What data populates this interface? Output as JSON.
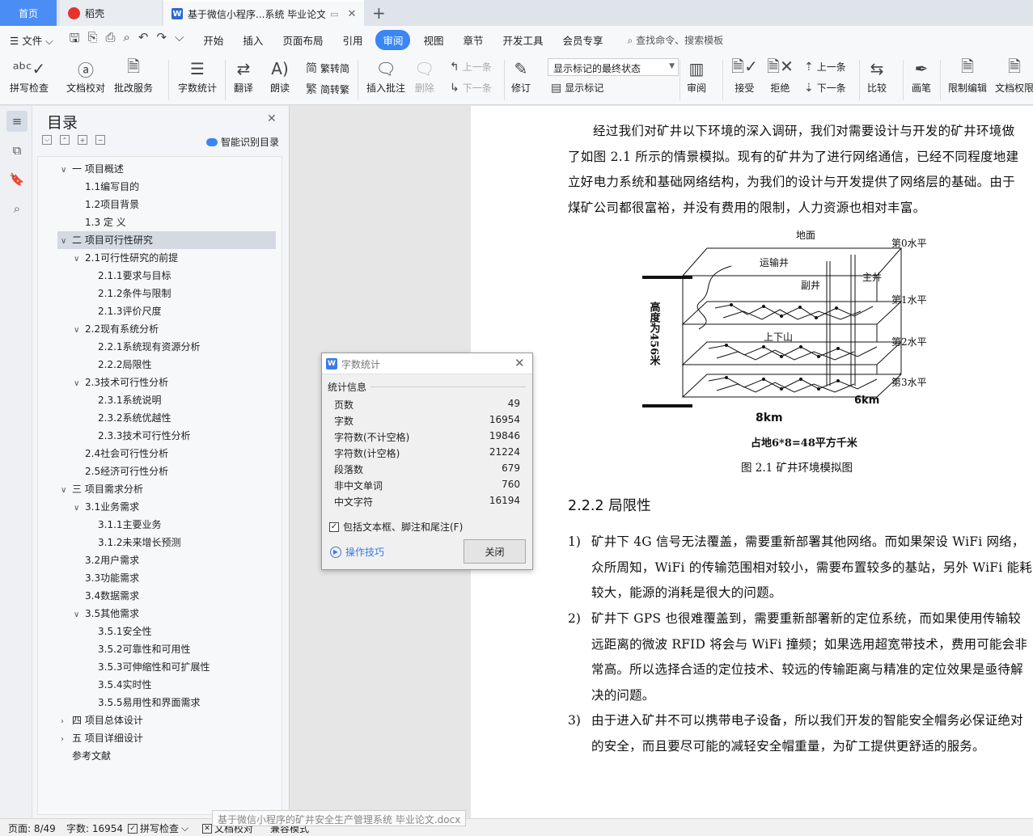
{
  "tabs": {
    "home": "首页",
    "daoke": "稻壳",
    "doc": "基于微信小程序...系统 毕业论文",
    "doc_close": "✕",
    "new_tab": "+"
  },
  "menu": {
    "file": "文件",
    "items": [
      "开始",
      "插入",
      "页面布局",
      "引用",
      "审阅",
      "视图",
      "章节",
      "开发工具",
      "会员专享"
    ],
    "active": "审阅",
    "search": "查找命令、搜索模板"
  },
  "ribbon": {
    "spell": "拼写检查",
    "doc_check": "文档校对",
    "annot_service": "批改服务",
    "word_count": "字数统计",
    "translate": "翻译",
    "read_aloud": "朗读",
    "trad": "繁转简",
    "simp": "简转繁",
    "insert_comment": "插入批注",
    "delete": "删除",
    "prev_comment": "上一条",
    "next_comment": "下一条",
    "revise": "修订",
    "markup_state": "显示标记的最终状态",
    "show_markup": "显示标记",
    "review": "审阅",
    "accept": "接受",
    "reject": "拒绝",
    "prev": "上一条",
    "next": "下一条",
    "compare": "比较",
    "pen": "画笔",
    "restrict": "限制编辑",
    "doc_perm": "文档权限"
  },
  "toc": {
    "title": "目录",
    "ai_toc": "智能识别目录",
    "items": [
      {
        "label": "一 项目概述",
        "level": 1,
        "caret": "∨"
      },
      {
        "label": "1.1编写目的",
        "level": 2,
        "caret": ""
      },
      {
        "label": "1.2项目背景",
        "level": 2,
        "caret": ""
      },
      {
        "label": "1.3 定 义",
        "level": 2,
        "caret": ""
      },
      {
        "label": "二 项目可行性研究",
        "level": 1,
        "caret": "∨"
      },
      {
        "label": "2.1可行性研究的前提",
        "level": 2,
        "caret": "∨"
      },
      {
        "label": "2.1.1要求与目标",
        "level": 3,
        "caret": ""
      },
      {
        "label": "2.1.2条件与限制",
        "level": 3,
        "caret": ""
      },
      {
        "label": "2.1.3评价尺度",
        "level": 3,
        "caret": ""
      },
      {
        "label": "2.2现有系统分析",
        "level": 2,
        "caret": "∨"
      },
      {
        "label": "2.2.1系统现有资源分析",
        "level": 3,
        "caret": ""
      },
      {
        "label": "2.2.2局限性",
        "level": 3,
        "caret": ""
      },
      {
        "label": "2.3技术可行性分析",
        "level": 2,
        "caret": "∨"
      },
      {
        "label": "2.3.1系统说明",
        "level": 3,
        "caret": ""
      },
      {
        "label": "2.3.2系统优越性",
        "level": 3,
        "caret": ""
      },
      {
        "label": "2.3.3技术可行性分析",
        "level": 3,
        "caret": ""
      },
      {
        "label": "2.4社会可行性分析",
        "level": 2,
        "caret": ""
      },
      {
        "label": "2.5经济可行性分析",
        "level": 2,
        "caret": ""
      },
      {
        "label": "三 项目需求分析",
        "level": 1,
        "caret": "∨"
      },
      {
        "label": "3.1业务需求",
        "level": 2,
        "caret": "∨"
      },
      {
        "label": "3.1.1主要业务",
        "level": 3,
        "caret": ""
      },
      {
        "label": "3.1.2未来增长预测",
        "level": 3,
        "caret": ""
      },
      {
        "label": "3.2用户需求",
        "level": 2,
        "caret": ""
      },
      {
        "label": "3.3功能需求",
        "level": 2,
        "caret": ""
      },
      {
        "label": "3.4数据需求",
        "level": 2,
        "caret": ""
      },
      {
        "label": "3.5其他需求",
        "level": 2,
        "caret": "∨"
      },
      {
        "label": "3.5.1安全性",
        "level": 3,
        "caret": ""
      },
      {
        "label": "3.5.2可靠性和可用性",
        "level": 3,
        "caret": ""
      },
      {
        "label": "3.5.3可伸缩性和可扩展性",
        "level": 3,
        "caret": ""
      },
      {
        "label": "3.5.4实时性",
        "level": 3,
        "caret": ""
      },
      {
        "label": "3.5.5易用性和界面需求",
        "level": 3,
        "caret": ""
      },
      {
        "label": "四 项目总体设计",
        "level": 1,
        "caret": "›"
      },
      {
        "label": "五 项目详细设计",
        "level": 1,
        "caret": "›"
      },
      {
        "label": "参考文献",
        "level": 1,
        "caret": ""
      }
    ],
    "selected_index": 4
  },
  "doc": {
    "intro": "经过我们对矿井以下环境的深入调研，我们对需要设计与开发的矿井环境做了如图 2.1 所示的情景模拟。现有的矿井为了进行网络通信，已经不同程度地建立好电力系统和基础网络结构，为我们的设计与开发提供了网络层的基础。由于煤矿公司都很富裕，并没有费用的限制，人力资源也相对丰富。",
    "figure": {
      "ground": "地面",
      "level0": "第0水平",
      "level1": "第1水平",
      "level2": "第2水平",
      "level3": "第3水平",
      "shaft_transport": "运输井",
      "shaft_aux": "副井",
      "shaft_main": "主井",
      "updown": "上下山",
      "height_label": "高度为456米",
      "width_km": "8km",
      "depth_km": "6km",
      "area_note": "占地6*8=48平方千米",
      "caption": "图 2.1 矿井环境模拟图"
    },
    "heading": "2.2.2  局限性",
    "items": [
      {
        "num": "1)",
        "text": "矿井下 4G 信号无法覆盖，需要重新部署其他网络。而如果架设 WiFi 网络，众所周知，WiFi 的传输范围相对较小，需要布置较多的基站，另外 WiFi 能耗较大，能源的消耗是很大的问题。"
      },
      {
        "num": "2)",
        "text": "矿井下 GPS 也很难覆盖到，需要重新部署新的定位系统，而如果使用传输较远距离的微波 RFID 将会与 WiFi 撞频；如果选用超宽带技术，费用可能会非常高。所以选择合适的定位技术、较远的传输距离与精准的定位效果是亟待解决的问题。"
      },
      {
        "num": "3)",
        "text": "由于进入矿井不可以携带电子设备，所以我们开发的智能安全帽务必保证绝对的安全，而且要尽可能的减轻安全帽重量，为矿工提供更舒适的服务。"
      }
    ]
  },
  "dialog": {
    "title": "字数统计",
    "section": "统计信息",
    "rows": [
      {
        "label": "页数",
        "value": "49"
      },
      {
        "label": "字数",
        "value": "16954"
      },
      {
        "label": "字符数(不计空格)",
        "value": "19846"
      },
      {
        "label": "字符数(计空格)",
        "value": "21224"
      },
      {
        "label": "段落数",
        "value": "679"
      },
      {
        "label": "非中文单词",
        "value": "760"
      },
      {
        "label": "中文字符",
        "value": "16194"
      }
    ],
    "checkbox": "包括文本框、脚注和尾注(F)",
    "checked": true,
    "tips": "操作技巧",
    "close": "关闭"
  },
  "status": {
    "page": "页面: 8/49",
    "words": "字数: 16954",
    "spell": "拼写检查",
    "doc_check": "文档校对",
    "compat": "兼容模式",
    "tooltip": "基于微信小程序的矿井安全生产管理系统 毕业论文.docx"
  },
  "colors": {
    "accent": "#3a86f2",
    "home_tab": "#4a8ef5"
  }
}
